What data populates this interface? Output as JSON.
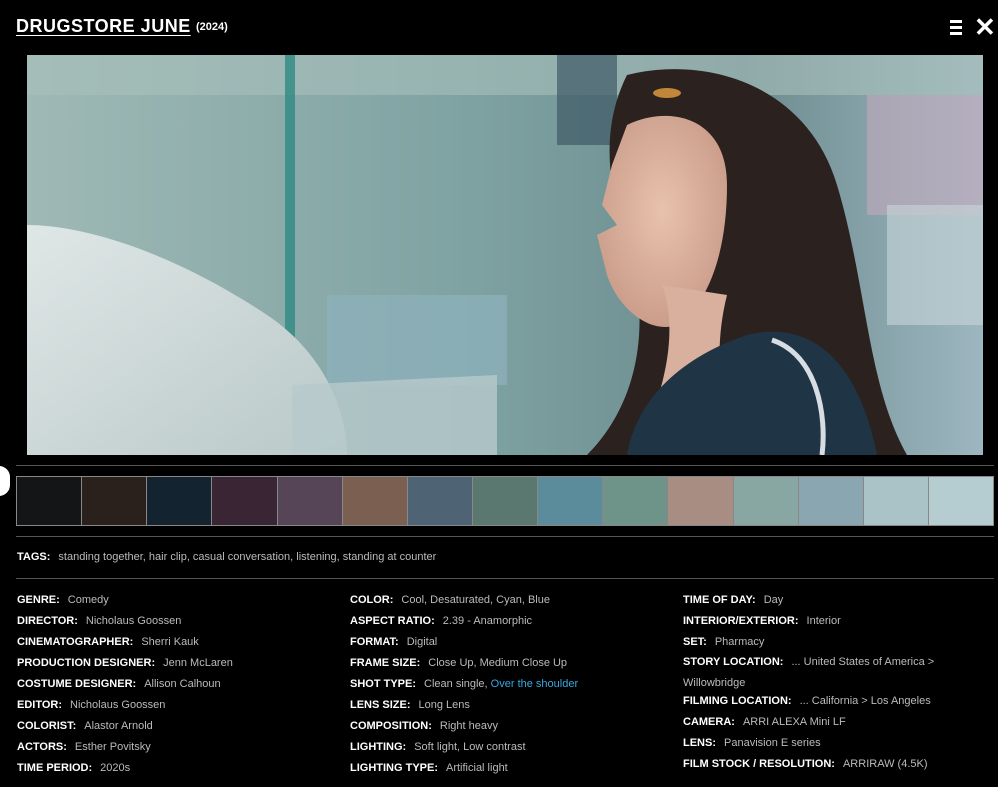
{
  "header": {
    "title": "DRUGSTORE JUNE",
    "year": "(2024)"
  },
  "icons": {
    "menu": "menu-icon",
    "close": "close-icon"
  },
  "palette": [
    "#141516",
    "#2a211d",
    "#142330",
    "#3a2534",
    "#564556",
    "#7b5f51",
    "#4e6474",
    "#5b7870",
    "#5b8c9c",
    "#6e9489",
    "#a88e82",
    "#88a7a3",
    "#8aa7b1",
    "#a9c3c7",
    "#b5cdd1"
  ],
  "tags": {
    "label": "TAGS:",
    "value": "standing together, hair clip, casual conversation, listening, standing at counter"
  },
  "details": {
    "col1": [
      {
        "label": "GENRE:",
        "value": "Comedy"
      },
      {
        "label": "DIRECTOR:",
        "value": "Nicholaus Goossen"
      },
      {
        "label": "CINEMATOGRAPHER:",
        "value": "Sherri Kauk"
      },
      {
        "label": "PRODUCTION DESIGNER:",
        "value": "Jenn McLaren"
      },
      {
        "label": "COSTUME DESIGNER:",
        "value": "Allison Calhoun"
      },
      {
        "label": "EDITOR:",
        "value": "Nicholaus Goossen"
      },
      {
        "label": "COLORIST:",
        "value": "Alastor Arnold"
      },
      {
        "label": "ACTORS:",
        "value": "Esther Povitsky"
      },
      {
        "label": "TIME PERIOD:",
        "value": "2020s"
      }
    ],
    "col2": [
      {
        "label": "COLOR:",
        "value": "Cool, Desaturated, Cyan, Blue"
      },
      {
        "label": "ASPECT RATIO:",
        "value": "2.39 - Anamorphic"
      },
      {
        "label": "FORMAT:",
        "value": "Digital"
      },
      {
        "label": "FRAME SIZE:",
        "value": "Close Up, Medium Close Up"
      },
      {
        "label": "SHOT TYPE:",
        "value": "Clean single,",
        "link": "Over the shoulder"
      },
      {
        "label": "LENS SIZE:",
        "value": "Long Lens"
      },
      {
        "label": "COMPOSITION:",
        "value": "Right heavy"
      },
      {
        "label": "LIGHTING:",
        "value": "Soft light, Low contrast"
      },
      {
        "label": "LIGHTING TYPE:",
        "value": "Artificial light"
      }
    ],
    "col3": [
      {
        "label": "TIME OF DAY:",
        "value": "Day"
      },
      {
        "label": "INTERIOR/EXTERIOR:",
        "value": "Interior"
      },
      {
        "label": "SET:",
        "value": "Pharmacy"
      },
      {
        "label": "STORY LOCATION:",
        "value": "... United States of America > Willowbridge"
      },
      {
        "label": "FILMING LOCATION:",
        "value": "... California > Los Angeles"
      },
      {
        "label": "CAMERA:",
        "value": "ARRI ALEXA Mini LF"
      },
      {
        "label": "LENS:",
        "value": "Panavision E series"
      },
      {
        "label": "FILM STOCK / RESOLUTION:",
        "value": "ARRIRAW (4.5K)"
      }
    ]
  }
}
